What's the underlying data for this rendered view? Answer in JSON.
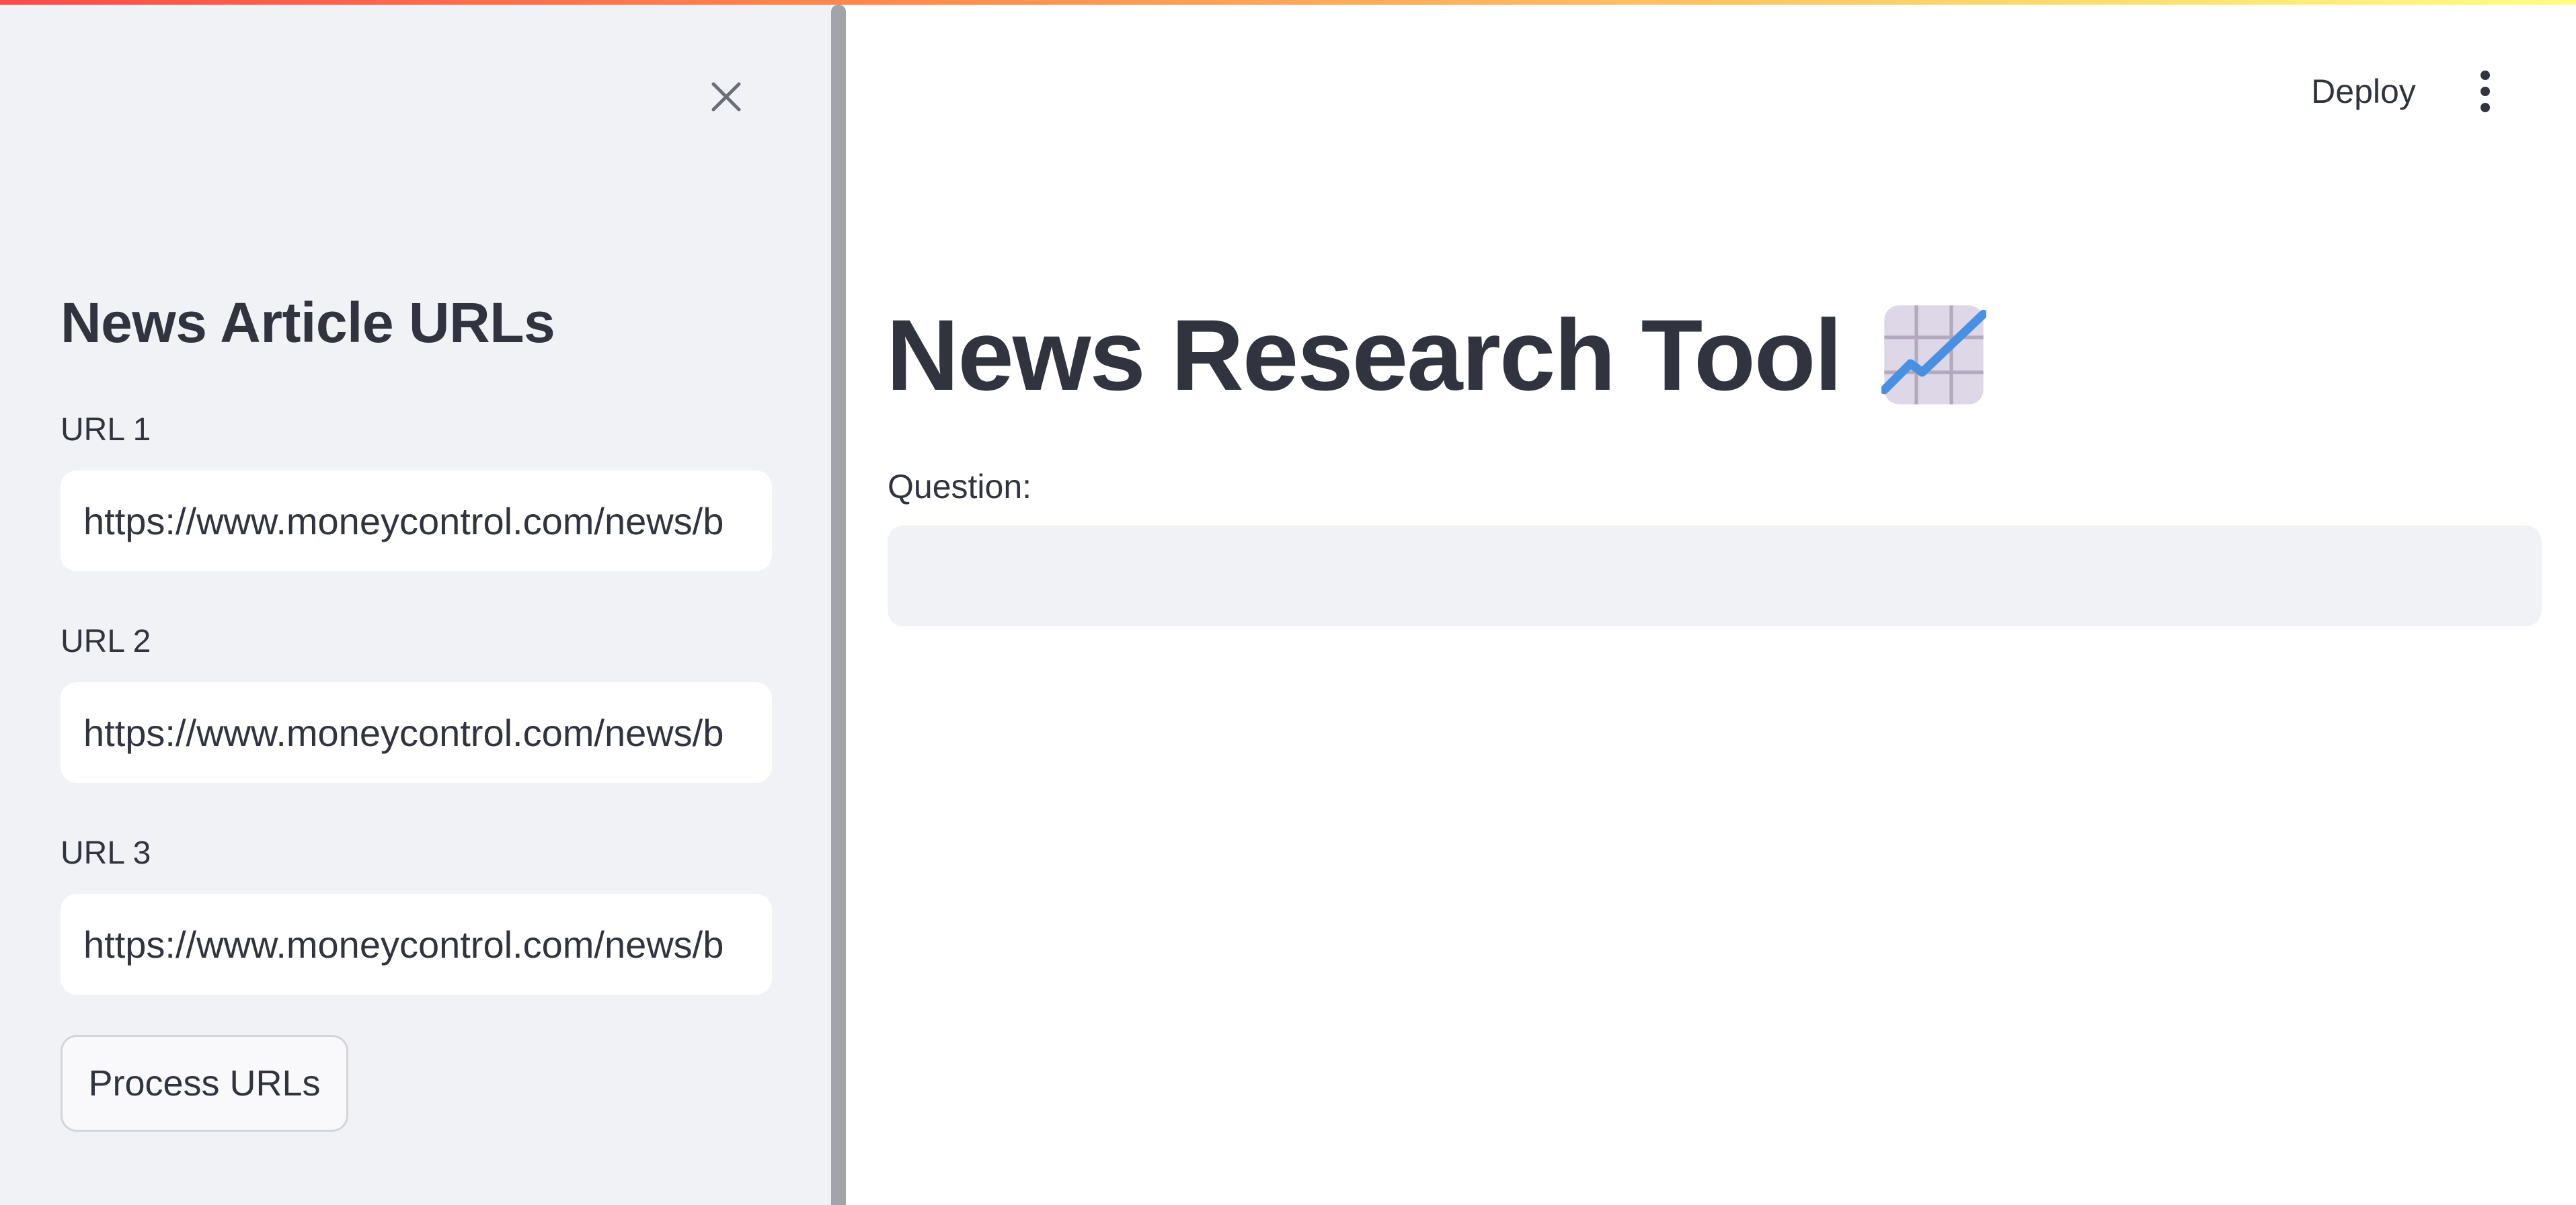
{
  "sidebar": {
    "title": "News Article URLs",
    "close_icon": "close-icon",
    "urls": [
      {
        "label": "URL 1",
        "value": "https://www.moneycontrol.com/news/b"
      },
      {
        "label": "URL 2",
        "value": "https://www.moneycontrol.com/news/b"
      },
      {
        "label": "URL 3",
        "value": "https://www.moneycontrol.com/news/b"
      }
    ],
    "process_button": "Process URLs"
  },
  "header": {
    "deploy_label": "Deploy",
    "menu_icon": "vertical-ellipsis-icon"
  },
  "main": {
    "title": "News Research Tool",
    "title_icon": "chart-increasing-icon",
    "question_label": "Question:",
    "question_value": ""
  },
  "colors": {
    "sidebar_bg": "#f0f2f6",
    "text": "#31333f",
    "input_bg_sidebar": "#ffffff",
    "input_bg_main": "#f0f2f6",
    "divider": "#a3a4ab",
    "accent_gradient_start": "#ff4b4b",
    "accent_gradient_end": "#fffd80"
  }
}
